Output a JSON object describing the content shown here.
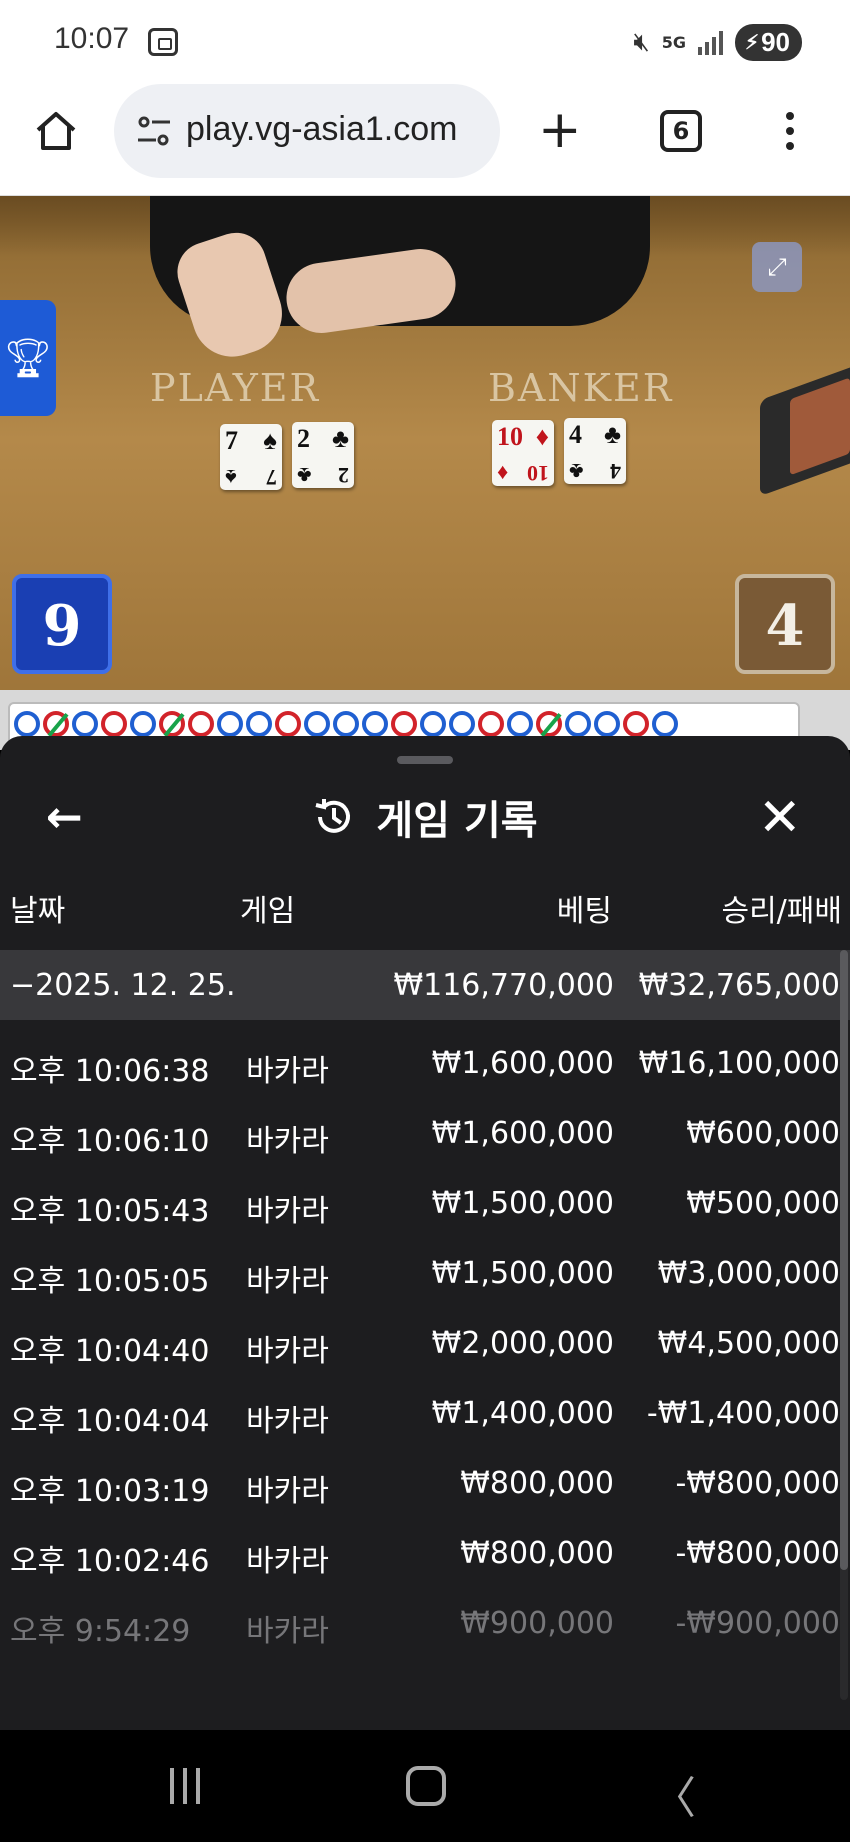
{
  "status_bar": {
    "time": "10:07",
    "network": "5G",
    "battery": "90"
  },
  "browser": {
    "url": "play.vg-asia1.com",
    "tab_count": "6"
  },
  "game": {
    "player_label": "PLAYER",
    "banker_label": "BANKER",
    "player_cards": [
      {
        "rank": "7",
        "suit": "♠",
        "color": "black"
      },
      {
        "rank": "2",
        "suit": "♣",
        "color": "black"
      }
    ],
    "banker_cards": [
      {
        "rank": "10",
        "suit": "♦",
        "color": "red"
      },
      {
        "rank": "4",
        "suit": "♣",
        "color": "black"
      }
    ],
    "player_score": "9",
    "banker_score": "4",
    "roadmap": [
      "P",
      "T",
      "P",
      "B",
      "P",
      "T",
      "B",
      "P",
      "P",
      "B",
      "P",
      "P",
      "P",
      "B",
      "P",
      "P",
      "B",
      "P",
      "T",
      "P",
      "P",
      "B",
      "P"
    ]
  },
  "history": {
    "title": "게임 기록",
    "columns": {
      "date": "날짜",
      "game": "게임",
      "bet": "베팅",
      "win_loss": "승리/패배"
    },
    "date_group": {
      "date": "−2025. 12. 25.",
      "bet_total": "₩116,770,000",
      "win_total": "₩32,765,000"
    },
    "rows": [
      {
        "time": "오후 10:06:38",
        "game": "바카라",
        "bet": "₩1,600,000",
        "result": "₩16,100,000"
      },
      {
        "time": "오후 10:06:10",
        "game": "바카라",
        "bet": "₩1,600,000",
        "result": "₩600,000"
      },
      {
        "time": "오후 10:05:43",
        "game": "바카라",
        "bet": "₩1,500,000",
        "result": "₩500,000"
      },
      {
        "time": "오후 10:05:05",
        "game": "바카라",
        "bet": "₩1,500,000",
        "result": "₩3,000,000"
      },
      {
        "time": "오후 10:04:40",
        "game": "바카라",
        "bet": "₩2,000,000",
        "result": "₩4,500,000"
      },
      {
        "time": "오후 10:04:04",
        "game": "바카라",
        "bet": "₩1,400,000",
        "result": "-₩1,400,000"
      },
      {
        "time": "오후 10:03:19",
        "game": "바카라",
        "bet": "₩800,000",
        "result": "-₩800,000"
      },
      {
        "time": "오후 10:02:46",
        "game": "바카라",
        "bet": "₩800,000",
        "result": "-₩800,000"
      },
      {
        "time": "오후 9:54:29",
        "game": "바카라",
        "bet": "₩900,000",
        "result": "-₩900,000"
      }
    ]
  },
  "icons": {
    "home": "home-icon",
    "site_settings": "tune-icon",
    "new_tab": "plus-icon",
    "tabs": "tabs-icon",
    "menu": "more-vert-icon",
    "fullscreen": "fullscreen-icon",
    "trophy": "trophy-icon",
    "back": "arrow-left-icon",
    "history": "history-icon",
    "close": "close-icon"
  }
}
